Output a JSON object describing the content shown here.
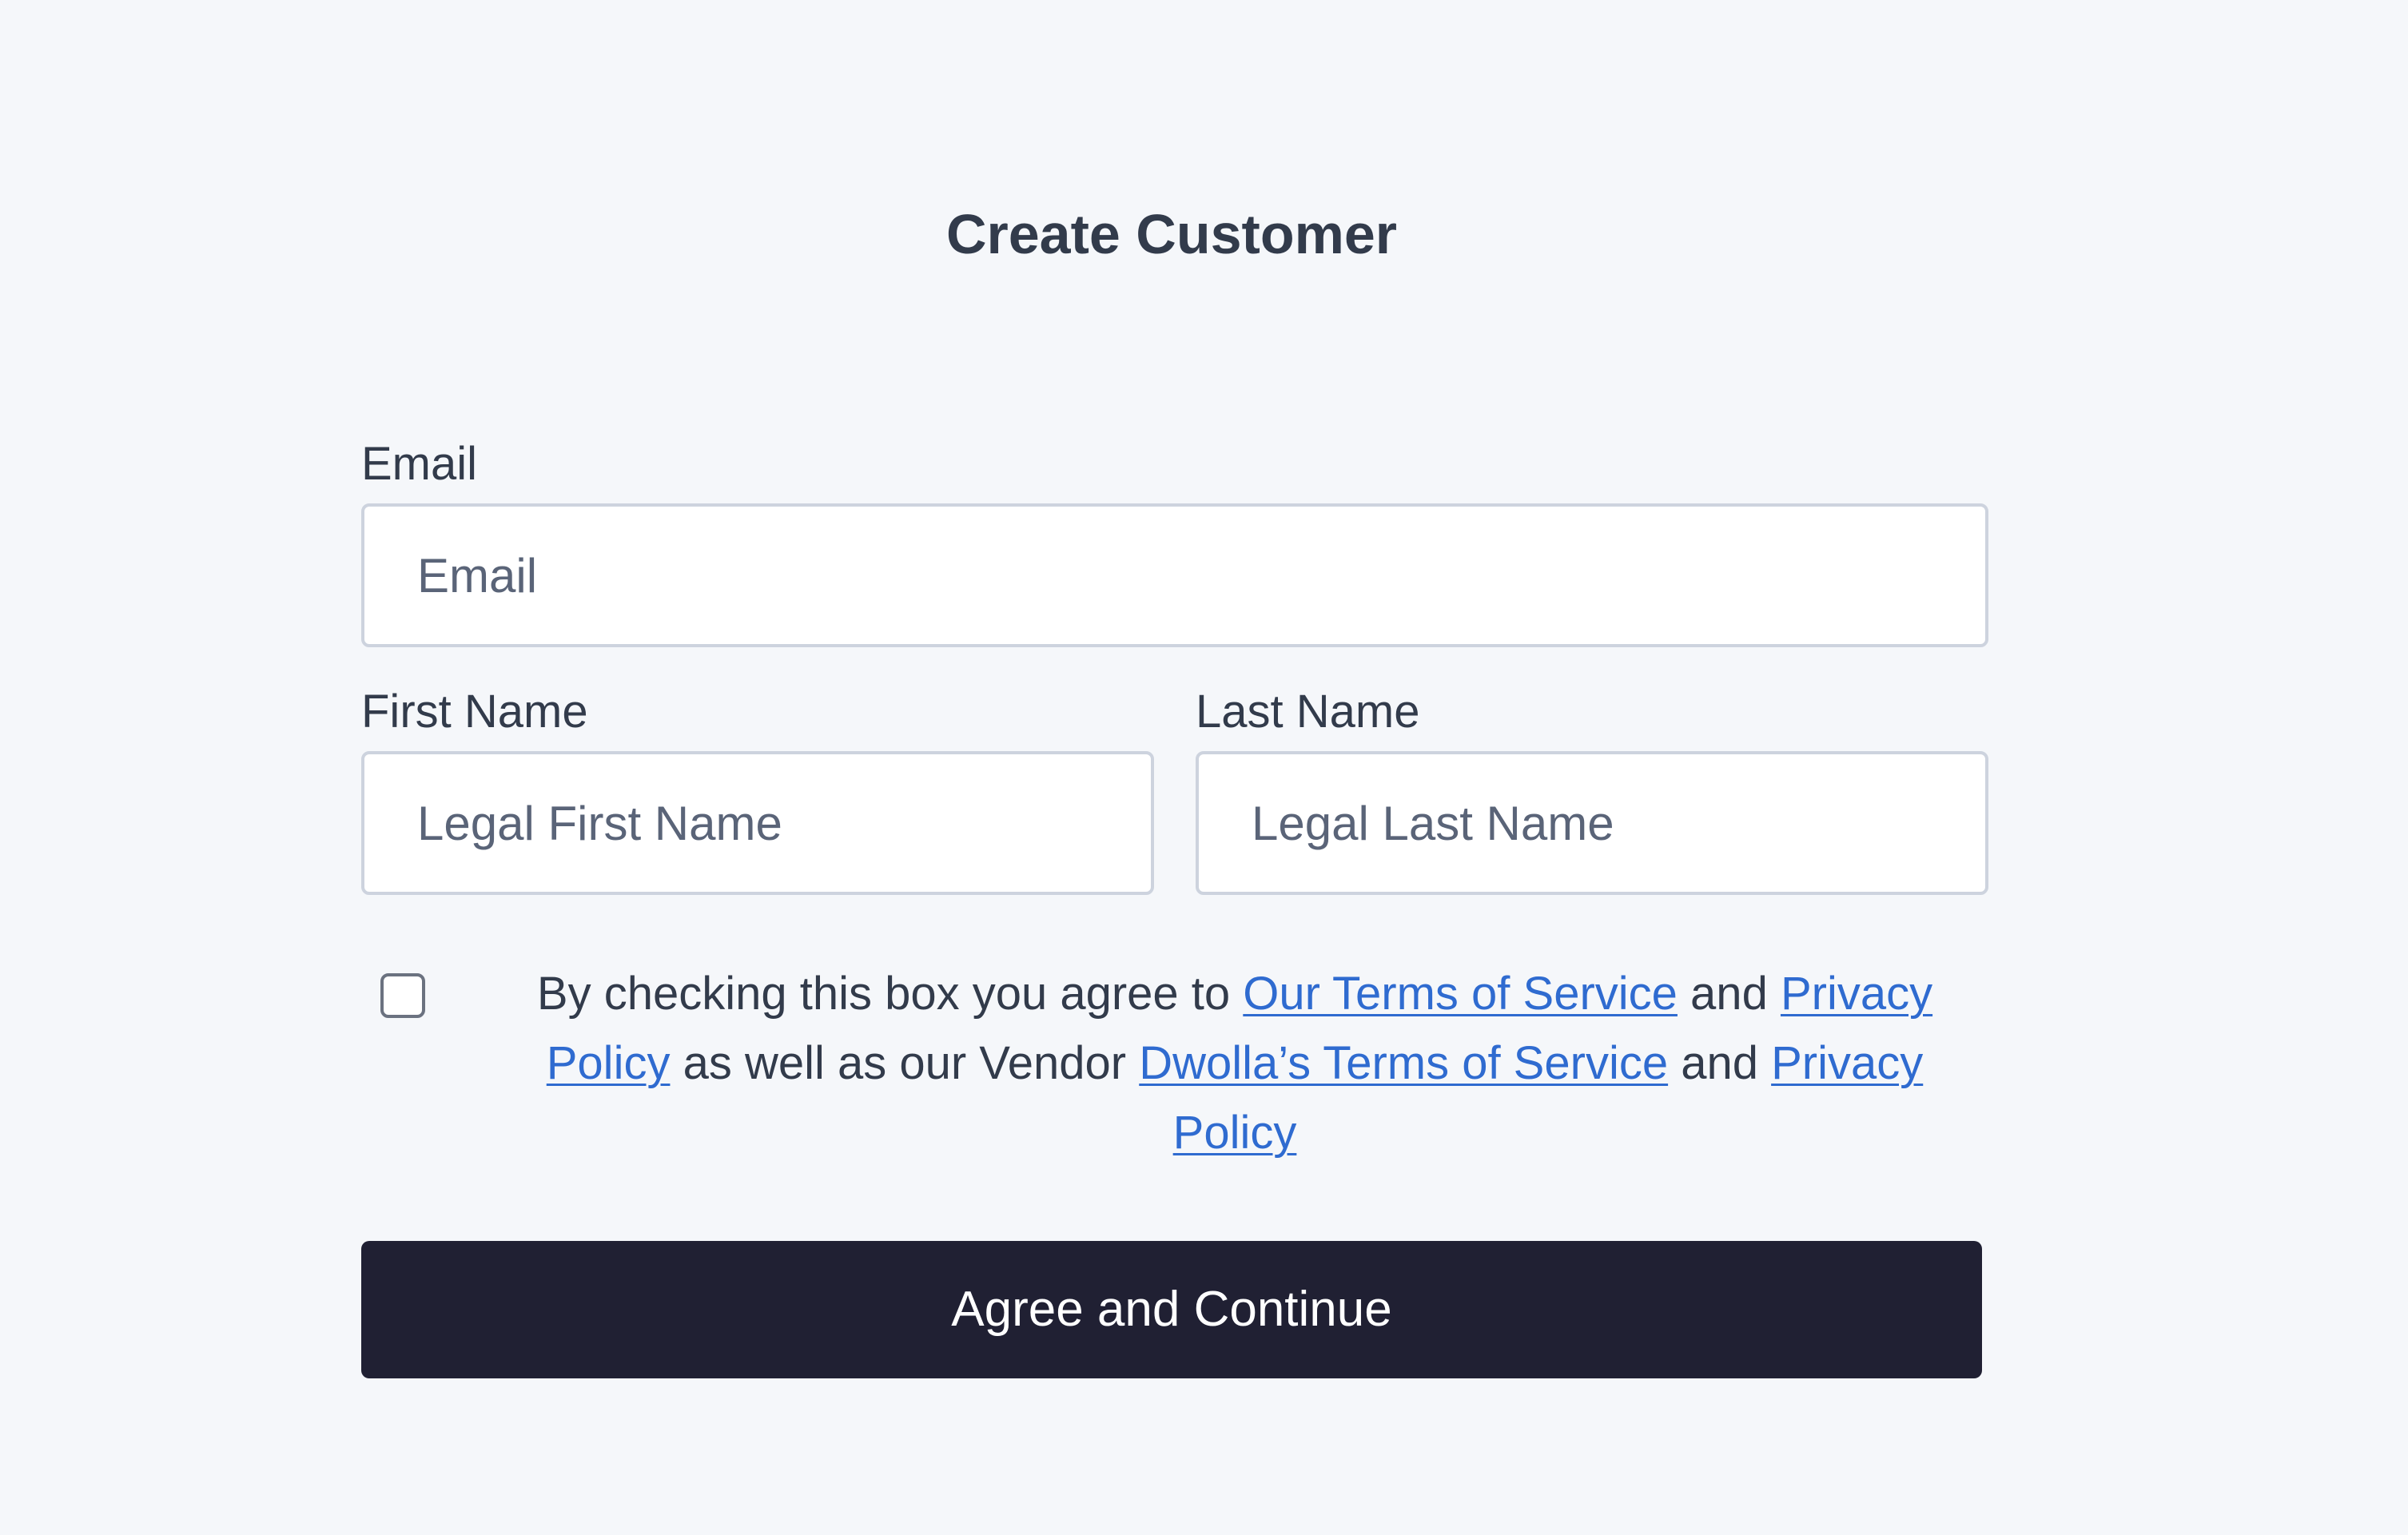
{
  "page": {
    "title": "Create Customer"
  },
  "form": {
    "email": {
      "label": "Email",
      "placeholder": "Email",
      "value": ""
    },
    "first_name": {
      "label": "First Name",
      "placeholder": "Legal First Name",
      "value": ""
    },
    "last_name": {
      "label": "Last Name",
      "placeholder": "Legal Last Name",
      "value": ""
    },
    "consent": {
      "checked": false,
      "text_1": "By checking this box you agree to ",
      "link_terms": "Our Terms of Service",
      "text_2": " and ",
      "link_privacy": "Privacy Policy",
      "text_3": " as well as our Vendor ",
      "link_dwolla_terms": "Dwolla’s Terms of Service",
      "text_4": " and ",
      "link_dwolla_privacy": "Privacy Policy"
    },
    "submit_label": "Agree and Continue"
  },
  "colors": {
    "background": "#f5f7fa",
    "text": "#323b4b",
    "link": "#2f6bd0",
    "button": "#202033",
    "input_border": "#cdd3de"
  },
  "icons": {
    "checkbox": "checkbox-unchecked-icon"
  }
}
